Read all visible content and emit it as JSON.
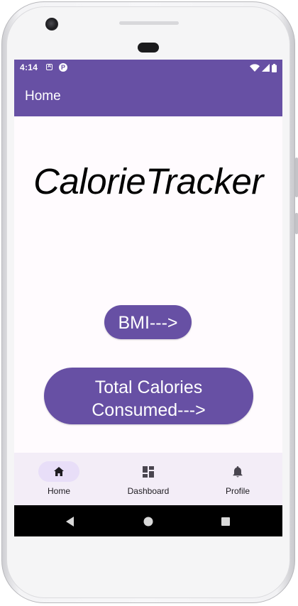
{
  "status_bar": {
    "time": "4:14",
    "color": "#6750a4",
    "icons": [
      "accessibility-icon",
      "notification-p-icon",
      "wifi-icon",
      "signal-icon",
      "battery-icon"
    ]
  },
  "app_bar": {
    "title": "Home"
  },
  "main": {
    "title": "CalorieTracker",
    "bmi_button": "BMI--->",
    "total_button_line1": "Total Calories",
    "total_button_line2": "Consumed--->"
  },
  "bottom_nav": {
    "selected": "Home",
    "items": [
      {
        "label": "Home",
        "icon": "home-icon"
      },
      {
        "label": "Dashboard",
        "icon": "dashboard-icon"
      },
      {
        "label": "Profile",
        "icon": "bell-icon"
      }
    ]
  },
  "system_nav": {
    "buttons": [
      "back-icon",
      "home-circle-icon",
      "recents-icon"
    ]
  },
  "colors": {
    "primary": "#6750a4",
    "nav_background": "#f3edf7",
    "nav_indicator": "#e8def8",
    "screen_background": "#fffbfe"
  }
}
